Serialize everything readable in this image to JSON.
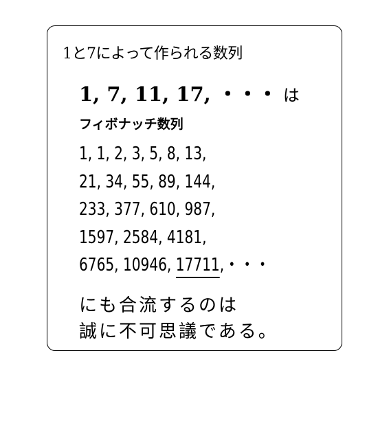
{
  "card": {
    "title": "1と7によって作られる数列",
    "sequence": "1, 7, 11, 17, ・・・",
    "sequence_particle": "は",
    "fibonacci_title": "フィボナッチ数列",
    "fibonacci_lines": [
      "1, 1, 2, 3, 5, 8, 13,",
      "21, 34, 55, 89, 144,",
      "233, 377, 610, 987,",
      "1597, 2584, 4181,"
    ],
    "last_line_prefix": "6765, 10946, ",
    "last_line_highlight": "17711",
    "last_line_suffix": ",・・・",
    "closing_lines": [
      "にも合流するのは",
      "誠に不可思議である。"
    ]
  }
}
